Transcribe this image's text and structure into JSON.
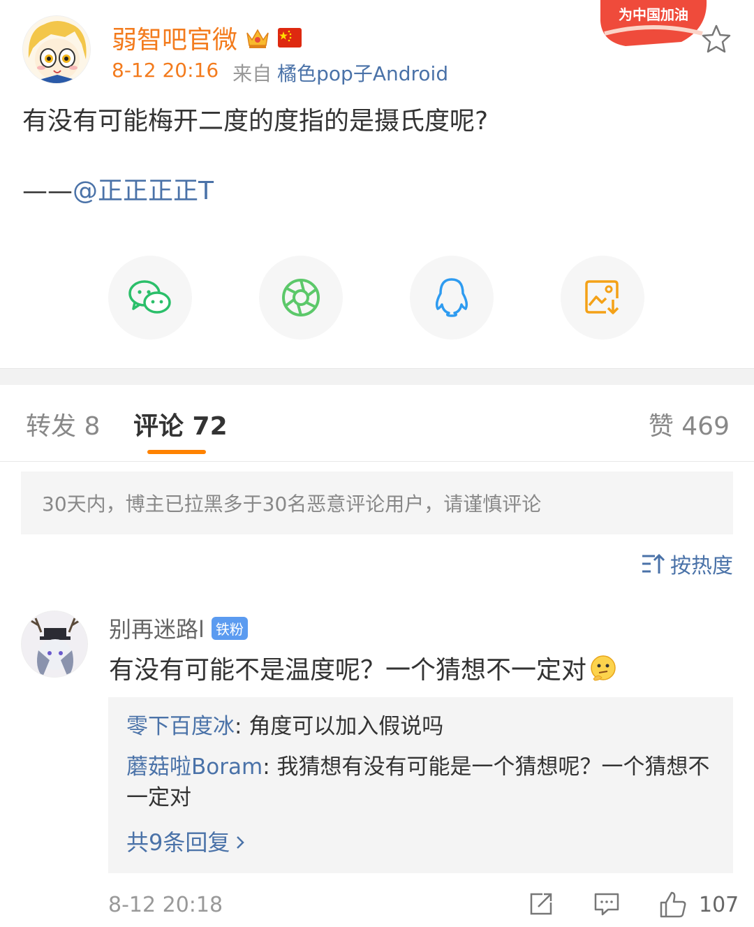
{
  "post": {
    "author": "弱智吧官微",
    "time": "8-12 20:16",
    "from_label": "来自",
    "source": "橘色pop子Android",
    "badge_text": "为中国加油",
    "text_line1": "有没有可能梅开二度的度指的是摄氏度呢?",
    "text_line2_prefix": "——",
    "text_line2_mention": "@正正正正T"
  },
  "share": {
    "items": [
      "wechat-icon",
      "moments-icon",
      "qq-icon",
      "save-image-icon"
    ]
  },
  "tabs": {
    "repost": "转发 8",
    "comments": "评论 72",
    "likes": "赞 469"
  },
  "notice": "30天内，博主已拉黑多于30名恶意评论用户，请谨慎评论",
  "sort_label": "按热度",
  "comment": {
    "user": "别再迷路l",
    "badge": "铁粉",
    "text": "有没有可能不是温度呢？一个猜想不一定对",
    "replies": [
      {
        "name": "零下百度冰",
        "sep": ": ",
        "text": "角度可以加入假说吗"
      },
      {
        "name": "蘑菇啦Boram",
        "sep": ": ",
        "text": "我猜想有没有可能是一个猜想呢？一个猜想不一定对"
      }
    ],
    "more_replies": "共9条回复",
    "time": "8-12 20:18",
    "likes": "107"
  },
  "colors": {
    "accent": "#f37b1d",
    "link": "#4a72a8",
    "tab_underline": "#ff8200"
  }
}
